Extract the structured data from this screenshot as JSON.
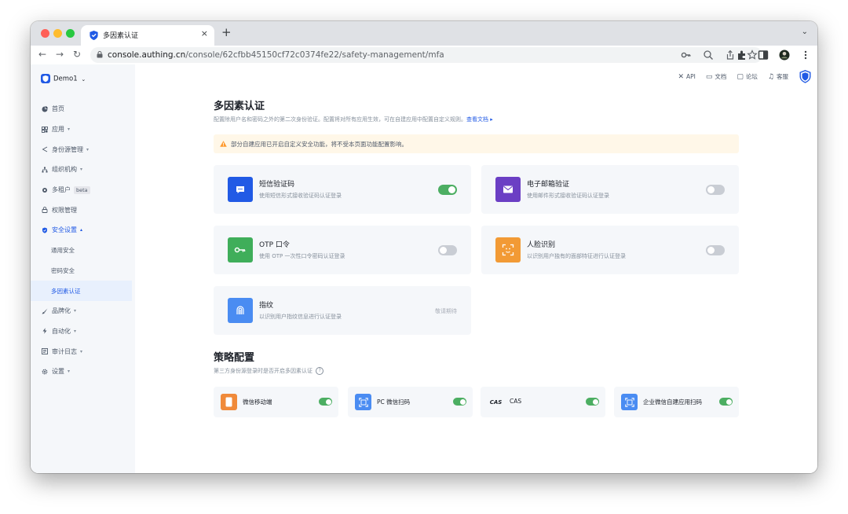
{
  "browser": {
    "tab_title": "多因素认证",
    "tab_close": "×",
    "new_tab": "+",
    "tabs_menu": "⌄",
    "nav_back": "←",
    "nav_forward": "→",
    "nav_reload": "↻",
    "url_domain": "console.authing.cn",
    "url_path": "/console/62cfbb45150cf72c0374fe22/safety-management/mfa"
  },
  "header": {
    "links": [
      {
        "icon": "close-x-icon",
        "glyph": "✕",
        "label": "API"
      },
      {
        "icon": "document-icon",
        "glyph": "▭",
        "label": "文档"
      },
      {
        "icon": "forum-icon",
        "glyph": "▢",
        "label": "论坛"
      },
      {
        "icon": "headset-icon",
        "glyph": "♫",
        "label": "客服"
      }
    ]
  },
  "sidebar": {
    "app_name": "Demo1",
    "app_caret": "⌄",
    "items": [
      {
        "label": "首页",
        "icon": "pie-icon",
        "caret": ""
      },
      {
        "label": "应用",
        "icon": "apps-icon",
        "caret": "▾"
      },
      {
        "label": "身份源管理",
        "icon": "share-icon",
        "caret": "▾"
      },
      {
        "label": "组织机构",
        "icon": "org-icon",
        "caret": "▾"
      },
      {
        "label": "多租户",
        "icon": "tenant-icon",
        "caret": "",
        "badge": "beta"
      },
      {
        "label": "权限管理",
        "icon": "permission-icon",
        "caret": ""
      },
      {
        "label": "安全设置",
        "icon": "security-icon",
        "caret": "▴"
      },
      {
        "label": "通用安全",
        "sub": true
      },
      {
        "label": "密码安全",
        "sub": true
      },
      {
        "label": "多因素认证",
        "sub": true
      },
      {
        "label": "品牌化",
        "icon": "brand-icon",
        "caret": "▾"
      },
      {
        "label": "自动化",
        "icon": "automation-icon",
        "caret": "▾"
      },
      {
        "label": "审计日志",
        "icon": "audit-icon",
        "caret": "▾"
      },
      {
        "label": "设置",
        "icon": "settings-icon",
        "caret": "▾"
      }
    ]
  },
  "main": {
    "title": "多因素认证",
    "description": "配置除用户名和密码之外的第二次身份验证。配置将对所有应用生效，可在自建应用中配置自定义规则。",
    "doc_link": "查看文档 ▸",
    "alert": "部分自建应用已开启自定义安全功能，将不受本页面功能配置影响。",
    "mfa_methods": [
      {
        "title": "短信验证码",
        "desc": "使用短信形式接收验证码认证登录",
        "enabled": true,
        "color": "#215ae5"
      },
      {
        "title": "电子邮箱验证",
        "desc": "使用邮件形式接收验证码认证登录",
        "enabled": false,
        "color": "#6b3fc4"
      },
      {
        "title": "OTP 口令",
        "desc": "使用 OTP 一次性口令密码认证登录",
        "enabled": false,
        "color": "#3fae5a"
      },
      {
        "title": "人脸识别",
        "desc": "以识别用户独有的面部特征进行认证登录",
        "enabled": false,
        "color": "#f29a35"
      },
      {
        "title": "指纹",
        "desc": "以识别用户指纹信息进行认证登录",
        "coming_soon": "敬请期待",
        "color": "#4a8cf2"
      }
    ],
    "policy_title": "策略配置",
    "policy_desc": "第三方身份源登录时是否开启多因素认证",
    "policy_help": "?",
    "policies": [
      {
        "label": "微信移动端",
        "enabled": true,
        "color": "#f08a3a"
      },
      {
        "label": "PC 微信扫码",
        "enabled": true,
        "color": "#4a8cf2"
      },
      {
        "label": "CAS",
        "icon_text": "CAS",
        "enabled": true,
        "color": "#f5f7fa"
      },
      {
        "label": "企业微信自建应用扫码",
        "enabled": true,
        "color": "#4a8cf2"
      }
    ]
  }
}
